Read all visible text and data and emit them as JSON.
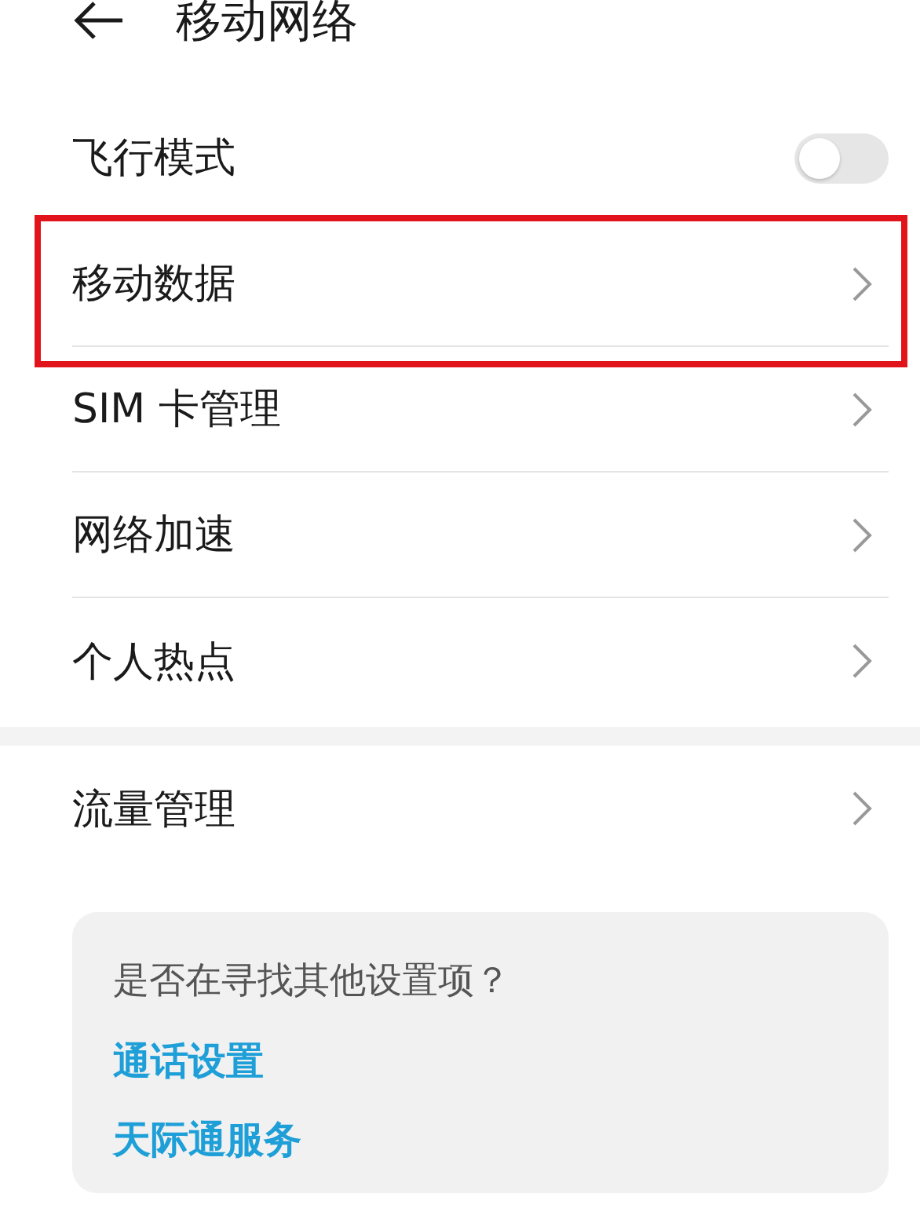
{
  "header": {
    "title": "移动网络"
  },
  "sections": [
    {
      "items": [
        {
          "kind": "toggle",
          "label": "飞行模式",
          "on": false,
          "highlighted": false
        },
        {
          "kind": "link",
          "label": "移动数据",
          "highlighted": true
        },
        {
          "kind": "link",
          "label": "SIM 卡管理",
          "highlighted": false
        },
        {
          "kind": "link",
          "label": "网络加速",
          "highlighted": false
        },
        {
          "kind": "link",
          "label": "个人热点",
          "highlighted": false
        }
      ]
    },
    {
      "items": [
        {
          "kind": "link",
          "label": "流量管理",
          "highlighted": false
        }
      ]
    }
  ],
  "suggestions": {
    "question": "是否在寻找其他设置项？",
    "links": [
      "通话设置",
      "天际通服务"
    ]
  }
}
